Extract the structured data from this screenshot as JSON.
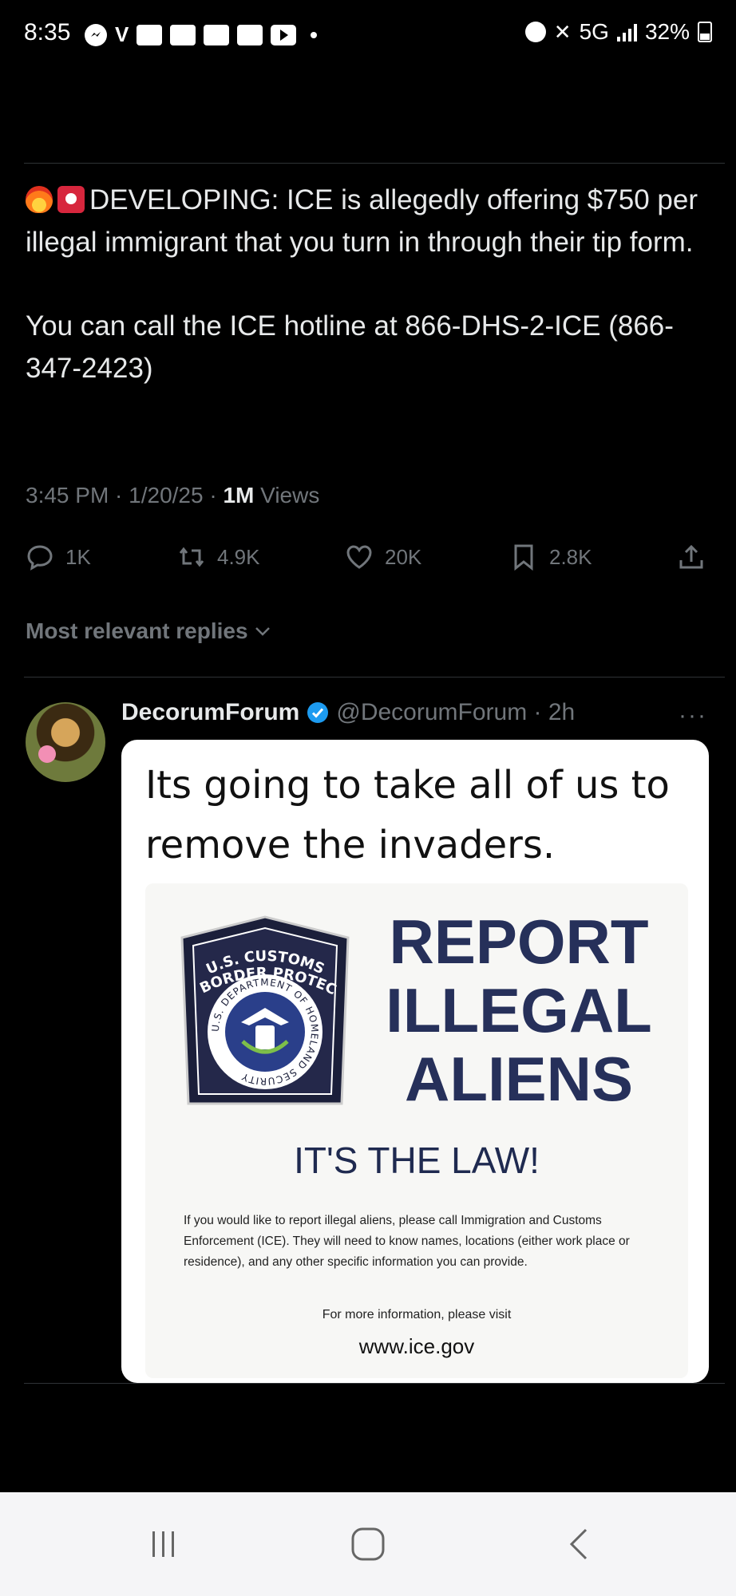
{
  "status_bar": {
    "time": "8:35",
    "network": "5G",
    "battery": "32%",
    "icons": [
      "messenger-icon",
      "v-icon",
      "samsung-box-icon",
      "samsung-box-icon",
      "samsung-box-icon",
      "samsung-box-icon",
      "youtube-icon",
      "notification-dot",
      "alarm-icon",
      "mute-icon",
      "signal-icon",
      "battery-icon"
    ]
  },
  "tweet": {
    "line1": "DEVELOPING: ICE is allegedly offering $750 per illegal immigrant that you turn in through their tip form.",
    "line2": "You can call the ICE hotline at 866-DHS-2-ICE (866-347-2423)",
    "meta_time": "3:45 PM · 1/20/25 · ",
    "meta_views_count": "1M",
    "meta_views_label": " Views",
    "actions": {
      "replies": "1K",
      "reposts": "4.9K",
      "likes": "20K",
      "bookmarks": "2.8K"
    }
  },
  "replies_sort": "Most relevant replies",
  "reply": {
    "name": "DecorumForum",
    "handle": "@DecorumForum · 2h",
    "more": "···",
    "quote": "Its going to take all of us to remove the invaders.",
    "poster": {
      "title_line1": "REPORT",
      "title_line2": "ILLEGAL",
      "title_line3": "ALIENS",
      "badge_top": "U.S. CUSTOMS AND BORDER PROTECTION",
      "badge_ring": "U.S. DEPARTMENT OF HOMELAND SECURITY",
      "law": "IT'S THE LAW!",
      "body": "If you would like to report illegal aliens, please call Immigration and Customs Enforcement (ICE). They will need to know names, locations (either work place or residence), and any other specific information you can provide.",
      "more_info": "For more information, please visit",
      "site": "www.ice.gov"
    }
  },
  "colors": {
    "background": "#000000",
    "text": "#e7e9ea",
    "muted": "#71767b",
    "verified": "#1d9bf0",
    "poster_navy": "#26305a"
  }
}
